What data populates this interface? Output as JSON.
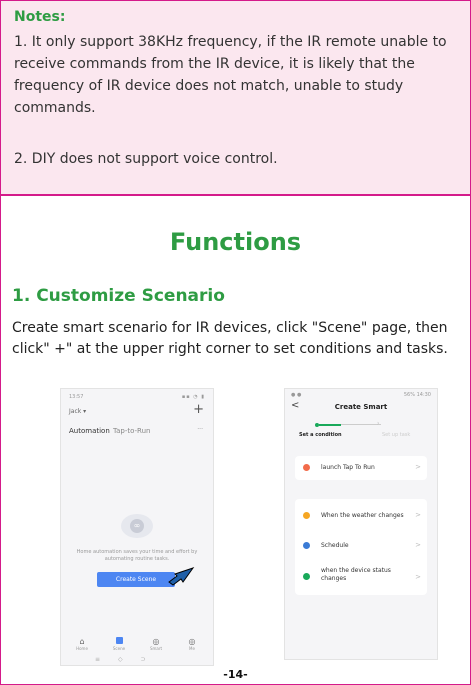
{
  "notes": {
    "title": "Notes:",
    "items": [
      "1. It only support 38KHz frequency, if the IR remote unable to receive commands from the IR device, it is likely that the frequency of IR device does not match, unable to study commands.",
      "2. DIY does not support voice control."
    ]
  },
  "functions_title": "Functions",
  "section": {
    "title": "1. Customize Scenario",
    "description": "Create smart scenario for IR devices, click \"Scene\" page, then click\" +\" at the upper right corner to set conditions and tasks."
  },
  "phone_left": {
    "status_time": "13:57",
    "user": "Jack",
    "add_icon": "plus-icon",
    "tabs": [
      "Automation",
      "Tap-to-Run"
    ],
    "more": "···",
    "empty_text": "Home automation saves your time and effort by automating routine tasks.",
    "create_button": "Create Scene",
    "nav": [
      {
        "label": "Home",
        "icon": "home-icon"
      },
      {
        "label": "Scene",
        "icon": "scene-icon"
      },
      {
        "label": "Smart",
        "icon": "smart-icon"
      },
      {
        "label": "Me",
        "icon": "me-icon"
      }
    ]
  },
  "phone_right": {
    "status_right": "56% 14:30",
    "back": "<",
    "title": "Create Smart",
    "steps": [
      "Set a condition",
      "Set up task"
    ],
    "options": [
      {
        "label": "launch Tap To Run",
        "icon": "tap-icon",
        "color": "#f26b4a"
      },
      {
        "label": "When the weather changes",
        "icon": "sun-icon",
        "color": "#f5a623"
      },
      {
        "label": "Schedule",
        "icon": "clock-icon",
        "color": "#3a7bd5"
      },
      {
        "label": "when the device status changes",
        "icon": "device-icon",
        "color": "#19a95a"
      }
    ],
    "chevron": ">"
  },
  "page_number": "-14-",
  "colors": {
    "accent": "#2e9c43",
    "border": "#d41a8a",
    "notes_bg": "#fbe7ef",
    "button": "#4d86f2"
  }
}
